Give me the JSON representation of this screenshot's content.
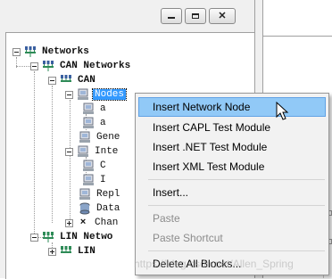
{
  "tree": {
    "networks": "Networks",
    "can_networks": "CAN Networks",
    "can": "CAN",
    "nodes": "Nodes",
    "child1": "a",
    "child2": "a",
    "generators": "Gene",
    "interactive": "Inte",
    "inter_child1": "C",
    "inter_child2": "I",
    "replay": "Repl",
    "database": "Data",
    "channel": "Chan",
    "lin_networks": "LIN Netwo",
    "lin": "LIN"
  },
  "context_menu": {
    "items": [
      {
        "label": "Insert Network Node",
        "state": "hover"
      },
      {
        "label": "Insert CAPL Test Module",
        "state": "enabled"
      },
      {
        "label": "Insert .NET Test Module",
        "state": "enabled"
      },
      {
        "label": "Insert XML Test Module",
        "state": "enabled"
      },
      {
        "label": "Insert...",
        "state": "enabled"
      },
      {
        "label": "Paste",
        "state": "disabled"
      },
      {
        "label": "Paste Shortcut",
        "state": "disabled"
      },
      {
        "label": "Delete All Blocks...",
        "state": "enabled"
      }
    ]
  },
  "watermark": "https://blog.csdn.net/Allen_Spring",
  "icons": [
    "network-icon",
    "bus-icon",
    "node-icon",
    "generator-icon",
    "interactive-icon",
    "replay-icon",
    "database-icon",
    "channel-filter-icon"
  ],
  "colors": {
    "selection": "#3399ff",
    "menu_hover": "#91c9f7",
    "menu_bg": "#f2f2f2",
    "icon_green": "#2e8b57",
    "icon_blue": "#3a5fa0"
  }
}
